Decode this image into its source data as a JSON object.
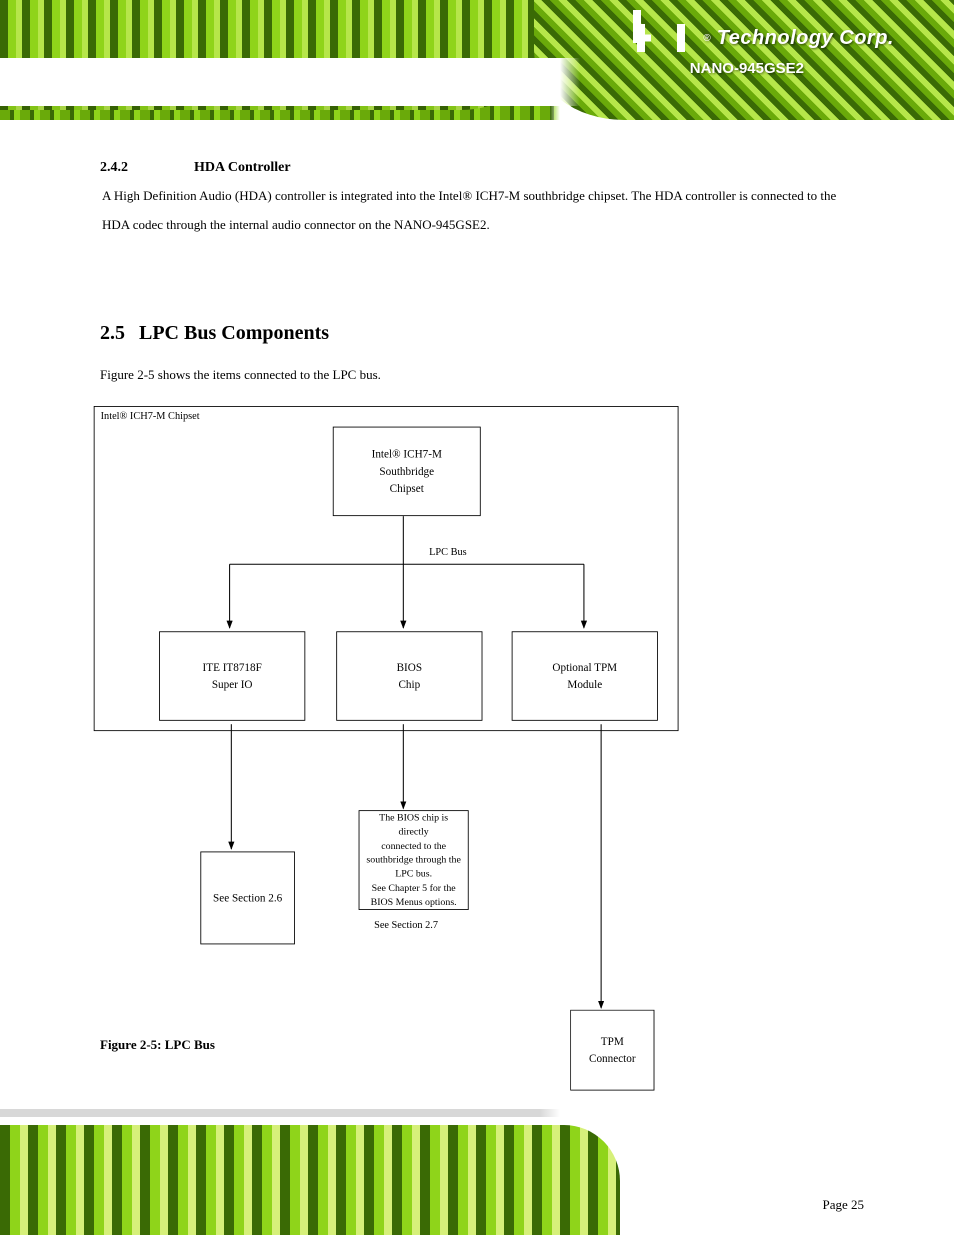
{
  "brand": {
    "name": "Technology Corp.",
    "registered_symbol": "®"
  },
  "product": "NANO-945GSE2",
  "section": {
    "number": "2.4.2",
    "title": "HDA Controller",
    "body": "A High Definition Audio (HDA) controller is integrated into the Intel® ICH7-M southbridge chipset. The HDA controller is connected to the HDA codec through the internal audio connector on the NANO-945GSE2."
  },
  "section2": {
    "number": "2.5",
    "title": "LPC Bus Components",
    "body": "Figure 2-5 shows the items connected to the LPC bus."
  },
  "diagram": {
    "ich7m": {
      "l1": "Intel® ICH7-M",
      "l2": "Southbridge",
      "l3": "Chipset"
    },
    "ich7m_group_label": "Intel® ICH7-M Chipset",
    "bus_label": "LPC Bus",
    "superio": {
      "l1": "ITE IT8718F",
      "l2": "Super IO"
    },
    "bios": {
      "l1": "BIOS",
      "l2": "Chip"
    },
    "tpm": {
      "l1": "Optional TPM",
      "l2": "Module"
    },
    "tpm_out": {
      "l1": "TPM",
      "l2": "Connector"
    },
    "section26": "See Section 2.6",
    "section27": "See Section 2.7",
    "bios_text1": "The BIOS chip is directly",
    "bios_text2": "connected to the",
    "bios_text3": "southbridge through the",
    "bios_text4": "LPC bus.",
    "bios_text5": "See Chapter 5 for the",
    "bios_text6": "BIOS Menus options.",
    "caption": "Figure 2-5: LPC Bus"
  },
  "page": "Page 25"
}
